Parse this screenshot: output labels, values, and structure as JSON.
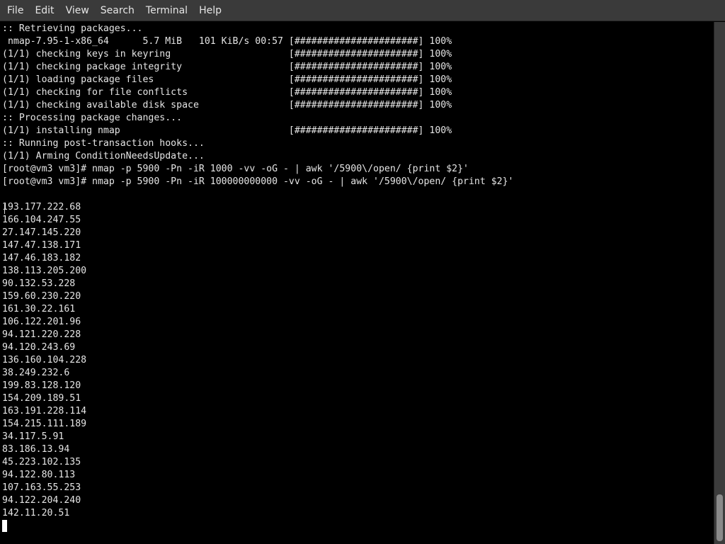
{
  "menu": {
    "file": "File",
    "edit": "Edit",
    "view": "View",
    "search": "Search",
    "terminal": "Terminal",
    "help": "Help"
  },
  "terminal": {
    "lines": [
      ":: Retrieving packages...",
      " nmap-7.95-1-x86_64      5.7 MiB   101 KiB/s 00:57 [######################] 100%",
      "(1/1) checking keys in keyring                     [######################] 100%",
      "(1/1) checking package integrity                   [######################] 100%",
      "(1/1) loading package files                        [######################] 100%",
      "(1/1) checking for file conflicts                  [######################] 100%",
      "(1/1) checking available disk space                [######################] 100%",
      ":: Processing package changes...",
      "(1/1) installing nmap                              [######################] 100%",
      ":: Running post-transaction hooks...",
      "(1/1) Arming ConditionNeedsUpdate...",
      "[root@vm3 vm3]# nmap -p 5900 -Pn -iR 1000 -vv -oG - | awk '/5900\\/open/ {print $2}'",
      "[root@vm3 vm3]# nmap -p 5900 -Pn -iR 100000000000 -vv -oG - | awk '/5900\\/open/ {print $2}'",
      "",
      "193.177.222.68",
      "166.104.247.55",
      "27.147.145.220",
      "147.47.138.171",
      "147.46.183.182",
      "138.113.205.200",
      "90.132.53.228",
      "159.60.230.220",
      "161.30.22.161",
      "106.122.201.96",
      "94.121.220.228",
      "94.120.243.69",
      "136.160.104.228",
      "38.249.232.6",
      "199.83.128.120",
      "154.209.189.51",
      "163.191.228.114",
      "154.215.111.189",
      "34.117.5.91",
      "83.186.13.94",
      "45.223.102.135",
      "94.122.80.113",
      "107.163.55.253",
      "94.122.204.240",
      "142.11.20.51"
    ]
  }
}
